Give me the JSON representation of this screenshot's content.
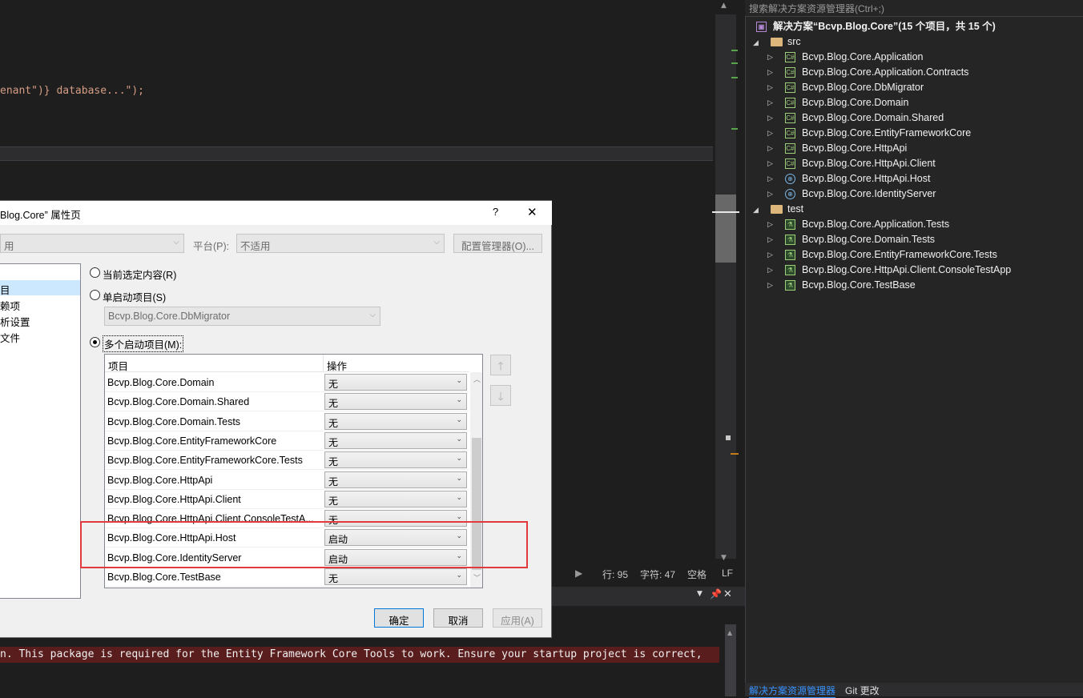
{
  "editor": {
    "code_line": "enant\")} database...\");"
  },
  "statusbar": {
    "line": "行: 95",
    "char": "字符: 47",
    "spaces": "空格",
    "eol": "LF"
  },
  "output": {
    "error_line": "n. This package is required for the Entity Framework Core Tools to work. Ensure your startup project is correct,"
  },
  "solution_explorer": {
    "search_placeholder": "搜索解决方案资源管理器(Ctrl+;)",
    "solution_label": "解决方案“Bcvp.Blog.Core”(15 个项目，共 15 个)",
    "folders": [
      {
        "name": "src",
        "projects": [
          {
            "name": "Bcvp.Blog.Core.Application",
            "icon": "csharp-project-icon"
          },
          {
            "name": "Bcvp.Blog.Core.Application.Contracts",
            "icon": "csharp-project-icon"
          },
          {
            "name": "Bcvp.Blog.Core.DbMigrator",
            "icon": "csharp-project-icon"
          },
          {
            "name": "Bcvp.Blog.Core.Domain",
            "icon": "csharp-project-icon"
          },
          {
            "name": "Bcvp.Blog.Core.Domain.Shared",
            "icon": "csharp-project-icon"
          },
          {
            "name": "Bcvp.Blog.Core.EntityFrameworkCore",
            "icon": "csharp-project-icon"
          },
          {
            "name": "Bcvp.Blog.Core.HttpApi",
            "icon": "csharp-project-icon"
          },
          {
            "name": "Bcvp.Blog.Core.HttpApi.Client",
            "icon": "csharp-project-icon"
          },
          {
            "name": "Bcvp.Blog.Core.HttpApi.Host",
            "icon": "web-project-icon"
          },
          {
            "name": "Bcvp.Blog.Core.IdentityServer",
            "icon": "web-project-icon"
          }
        ]
      },
      {
        "name": "test",
        "projects": [
          {
            "name": "Bcvp.Blog.Core.Application.Tests",
            "icon": "test-project-icon"
          },
          {
            "name": "Bcvp.Blog.Core.Domain.Tests",
            "icon": "test-project-icon"
          },
          {
            "name": "Bcvp.Blog.Core.EntityFrameworkCore.Tests",
            "icon": "test-project-icon"
          },
          {
            "name": "Bcvp.Blog.Core.HttpApi.Client.ConsoleTestApp",
            "icon": "test-project-icon"
          },
          {
            "name": "Bcvp.Blog.Core.TestBase",
            "icon": "test-project-icon"
          }
        ]
      }
    ],
    "bottom_tabs": [
      "解决方案资源管理器",
      "Git 更改"
    ]
  },
  "dialog": {
    "title": "Blog.Core” 属性页",
    "help": "?",
    "close": "✕",
    "config_value": "用",
    "platform_label": "平台(P):",
    "platform_value": "不适用",
    "config_manager": "配置管理器(O)...",
    "nav": [
      "目",
      "赖项",
      "析设置",
      "文件"
    ],
    "radio_current": "当前选定内容(R)",
    "radio_single": "单启动项目(S)",
    "single_value": "Bcvp.Blog.Core.DbMigrator",
    "radio_multi": "多个启动项目(M):",
    "grid_headers": [
      "项目",
      "操作"
    ],
    "rows": [
      {
        "project": "Bcvp.Blog.Core.Domain",
        "action": "无"
      },
      {
        "project": "Bcvp.Blog.Core.Domain.Shared",
        "action": "无"
      },
      {
        "project": "Bcvp.Blog.Core.Domain.Tests",
        "action": "无"
      },
      {
        "project": "Bcvp.Blog.Core.EntityFrameworkCore",
        "action": "无"
      },
      {
        "project": "Bcvp.Blog.Core.EntityFrameworkCore.Tests",
        "action": "无"
      },
      {
        "project": "Bcvp.Blog.Core.HttpApi",
        "action": "无"
      },
      {
        "project": "Bcvp.Blog.Core.HttpApi.Client",
        "action": "无"
      },
      {
        "project": "Bcvp.Blog.Core.HttpApi.Client.ConsoleTestA...",
        "action": "无"
      },
      {
        "project": "Bcvp.Blog.Core.HttpApi.Host",
        "action": "启动"
      },
      {
        "project": "Bcvp.Blog.Core.IdentityServer",
        "action": "启动"
      },
      {
        "project": "Bcvp.Blog.Core.TestBase",
        "action": "无"
      }
    ],
    "ok": "确定",
    "cancel": "取消",
    "apply": "应用(A)"
  }
}
